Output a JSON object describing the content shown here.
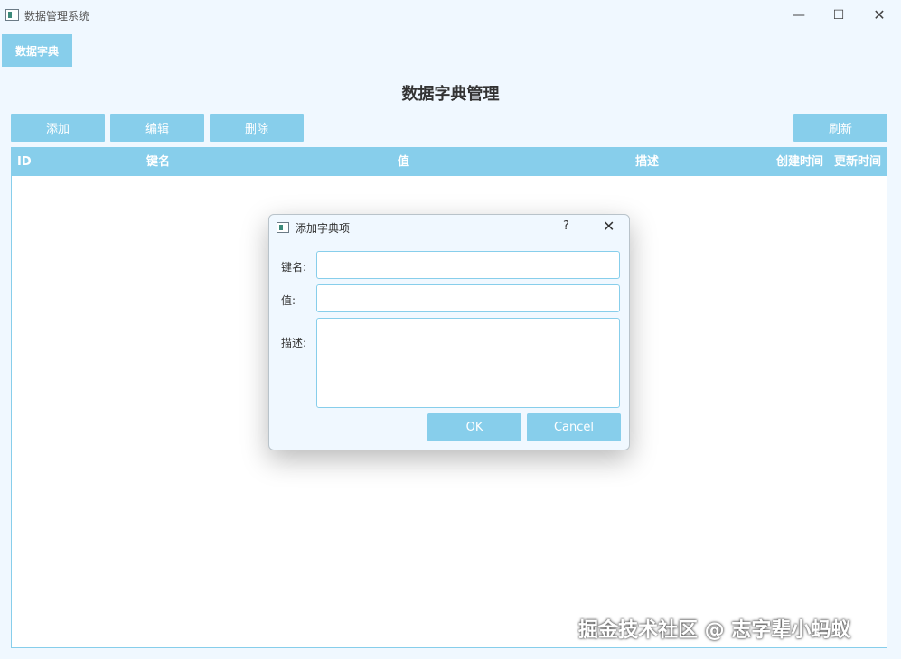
{
  "window": {
    "title": "数据管理系统",
    "minimize_glyph": "—",
    "maximize_glyph": "☐",
    "close_glyph": "✕"
  },
  "tabs": [
    {
      "label": "数据字典",
      "active": true
    }
  ],
  "main": {
    "page_title": "数据字典管理",
    "toolbar": {
      "add_label": "添加",
      "edit_label": "编辑",
      "delete_label": "删除",
      "refresh_label": "刷新"
    },
    "table": {
      "columns": [
        "ID",
        "键名",
        "值",
        "描述",
        "创建时间",
        "更新时间"
      ],
      "rows": []
    }
  },
  "dialog": {
    "title": "添加字典项",
    "help_glyph": "?",
    "close_glyph": "✕",
    "fields": {
      "key_label": "键名:",
      "key_value": "",
      "value_label": "值:",
      "value_value": "",
      "desc_label": "描述:",
      "desc_value": ""
    },
    "ok_label": "OK",
    "cancel_label": "Cancel"
  },
  "watermark": "掘金技术社区 @ 志字辈小蚂蚁",
  "colors": {
    "accent": "#87ceeb",
    "background": "#f0f8ff",
    "text": "#333333"
  }
}
